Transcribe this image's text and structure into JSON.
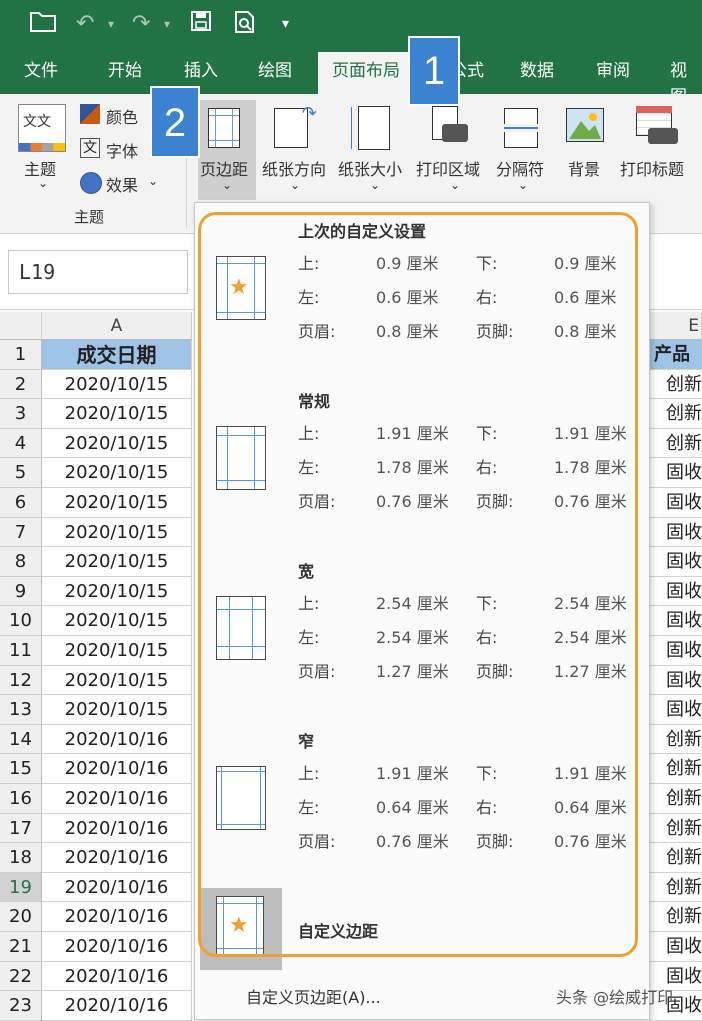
{
  "quick_access": {
    "save_icon": "save-icon",
    "preview_icon": "print-preview-icon"
  },
  "tabs": [
    "文件",
    "开始",
    "插入",
    "绘图",
    "页面布局",
    "公式",
    "数据",
    "审阅",
    "视图"
  ],
  "ribbon": {
    "theme_label": "主题",
    "colors_label": "颜色",
    "fonts_label": "字体",
    "effects_label": "效果",
    "group_label": "主题",
    "margins_label": "页边距",
    "orientation_label": "纸张方向",
    "size_label": "纸张大小",
    "print_area_label": "打印区域",
    "breaks_label": "分隔符",
    "background_label": "背景",
    "print_titles_label": "打印标题"
  },
  "badges": {
    "one": "1",
    "two": "2"
  },
  "name_box": "L19",
  "columns": {
    "a": "A",
    "right": "E"
  },
  "sheet": {
    "header_a": "成交日期",
    "header_right": "产品",
    "rows": [
      {
        "n": "1"
      },
      {
        "n": "2",
        "a": "2020/10/15",
        "r": "创新"
      },
      {
        "n": "3",
        "a": "2020/10/15",
        "r": "创新"
      },
      {
        "n": "4",
        "a": "2020/10/15",
        "r": "创新"
      },
      {
        "n": "5",
        "a": "2020/10/15",
        "r": "固收"
      },
      {
        "n": "6",
        "a": "2020/10/15",
        "r": "固收"
      },
      {
        "n": "7",
        "a": "2020/10/15",
        "r": "固收"
      },
      {
        "n": "8",
        "a": "2020/10/15",
        "r": "固收"
      },
      {
        "n": "9",
        "a": "2020/10/15",
        "r": "固收"
      },
      {
        "n": "10",
        "a": "2020/10/15",
        "r": "固收"
      },
      {
        "n": "11",
        "a": "2020/10/15",
        "r": "固收"
      },
      {
        "n": "12",
        "a": "2020/10/15",
        "r": "固收"
      },
      {
        "n": "13",
        "a": "2020/10/15",
        "r": "固收"
      },
      {
        "n": "14",
        "a": "2020/10/16",
        "r": "创新"
      },
      {
        "n": "15",
        "a": "2020/10/16",
        "r": "创新"
      },
      {
        "n": "16",
        "a": "2020/10/16",
        "r": "创新"
      },
      {
        "n": "17",
        "a": "2020/10/16",
        "r": "创新"
      },
      {
        "n": "18",
        "a": "2020/10/16",
        "r": "创新"
      },
      {
        "n": "19",
        "a": "2020/10/16",
        "r": "创新"
      },
      {
        "n": "20",
        "a": "2020/10/16",
        "r": "创新"
      },
      {
        "n": "21",
        "a": "2020/10/16",
        "r": "固收"
      },
      {
        "n": "22",
        "a": "2020/10/16",
        "r": "固收"
      },
      {
        "n": "23",
        "a": "2020/10/16",
        "r": "固收"
      }
    ]
  },
  "margins_menu": {
    "options": [
      {
        "title": "上次的自定义设置",
        "top": "0.9 厘米",
        "bottom": "0.9 厘米",
        "left": "0.6 厘米",
        "right": "0.6 厘米",
        "header": "0.8 厘米",
        "footer": "0.8 厘米"
      },
      {
        "title": "常规",
        "top": "1.91 厘米",
        "bottom": "1.91 厘米",
        "left": "1.78 厘米",
        "right": "1.78 厘米",
        "header": "0.76 厘米",
        "footer": "0.76 厘米"
      },
      {
        "title": "宽",
        "top": "2.54 厘米",
        "bottom": "2.54 厘米",
        "left": "2.54 厘米",
        "right": "2.54 厘米",
        "header": "1.27 厘米",
        "footer": "1.27 厘米"
      },
      {
        "title": "窄",
        "top": "1.91 厘米",
        "bottom": "1.91 厘米",
        "left": "0.64 厘米",
        "right": "0.64 厘米",
        "header": "0.76 厘米",
        "footer": "0.76 厘米"
      }
    ],
    "labels": {
      "top": "上:",
      "bottom": "下:",
      "left": "左:",
      "right": "右:",
      "header": "页眉:",
      "footer": "页脚:"
    },
    "custom_margins": "自定义边距",
    "custom_margins_link": "自定义页边距(A)..."
  },
  "watermark": "头条 @绘威打印",
  "colors": {
    "excel_green": "#217346",
    "badge_blue": "#3b82d0",
    "highlight_orange": "#f0a030",
    "header_blue": "#9dc3e6"
  }
}
